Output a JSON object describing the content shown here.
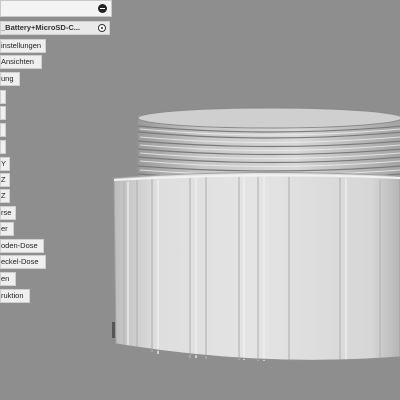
{
  "browser": {
    "root_label": "_Battery+MicroSD-C...",
    "items": [
      {
        "label": "instellungen"
      },
      {
        "label": "Ansichten"
      },
      {
        "label": "ung"
      },
      {
        "label": ""
      },
      {
        "label": ""
      },
      {
        "label": ""
      },
      {
        "label": ""
      },
      {
        "label": "Y"
      },
      {
        "label": "Z"
      },
      {
        "label": "Z"
      },
      {
        "label": "rse"
      },
      {
        "label": "er"
      },
      {
        "label": "oden-Dose"
      },
      {
        "label": "eckel-Dose"
      },
      {
        "label": "en"
      },
      {
        "label": "ruktion"
      }
    ]
  },
  "colors": {
    "viewport_background": "#8e8e8e",
    "part_color": "#dcdcdc"
  },
  "icons": [
    "collapse-icon",
    "active-radio-icon"
  ]
}
